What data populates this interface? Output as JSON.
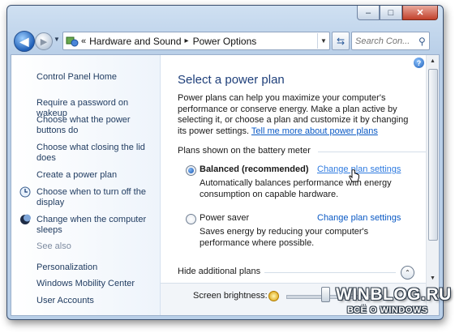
{
  "window": {
    "controls": {
      "minimize": "–",
      "maximize": "□",
      "close": "✕"
    }
  },
  "address": {
    "overflow": "«",
    "crumbs": [
      "Hardware and Sound",
      "Power Options"
    ],
    "separator": "▸",
    "search_placeholder": "Search Con..."
  },
  "sidebar": {
    "home": "Control Panel Home",
    "links": [
      "Require a password on wakeup",
      "Choose what the power buttons do",
      "Choose what closing the lid does",
      "Create a power plan",
      "Choose when to turn off the display",
      "Change when the computer sleeps"
    ],
    "see_also": "See also",
    "see_also_links": [
      "Personalization",
      "Windows Mobility Center",
      "User Accounts"
    ]
  },
  "main": {
    "title": "Select a power plan",
    "intro": "Power plans can help you maximize your computer's performance or conserve energy. Make a plan active by selecting it, or choose a plan and customize it by changing its power settings.",
    "intro_link": "Tell me more about power plans",
    "section_label": "Plans shown on the battery meter",
    "plans": [
      {
        "name": "Balanced (recommended)",
        "selected": true,
        "link": "Change plan settings",
        "description": "Automatically balances performance with energy consumption on capable hardware."
      },
      {
        "name": "Power saver",
        "selected": false,
        "link": "Change plan settings",
        "description": "Saves energy by reducing your computer's performance where possible."
      }
    ],
    "hide_label": "Hide additional plans",
    "brightness_label": "Screen brightness:"
  },
  "watermark": {
    "title": "WINBLOG.RU",
    "subtitle": "ВСЁ О WINDOWS"
  },
  "colors": {
    "link": "#0a59c4",
    "title": "#1e3f7a",
    "sidebar_text": "#1e3a5f"
  }
}
